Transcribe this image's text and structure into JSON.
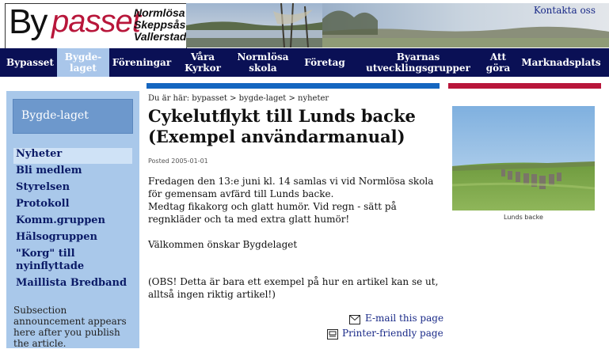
{
  "header": {
    "logo_by": "By",
    "logo_passet": "passet",
    "villages": [
      "Normlösa",
      "Skeppsås",
      "Vallerstad"
    ],
    "contact": "Kontakta oss"
  },
  "nav": {
    "items": [
      {
        "line1": "Bypasset",
        "line2": ""
      },
      {
        "line1": "Bygde-",
        "line2": "laget"
      },
      {
        "line1": "Föreningar",
        "line2": ""
      },
      {
        "line1": "Våra",
        "line2": "Kyrkor"
      },
      {
        "line1": "Normlösa",
        "line2": "skola"
      },
      {
        "line1": "Företag",
        "line2": ""
      },
      {
        "line1": "Byarnas",
        "line2": "utvecklingsgrupper"
      },
      {
        "line1": "Att",
        "line2": "göra"
      },
      {
        "line1": "Marknadsplats",
        "line2": ""
      }
    ]
  },
  "sidebar": {
    "title": "Bygde-laget",
    "links": [
      "Nyheter",
      "Bli medlem",
      "Styrelsen",
      "Protokoll",
      "Komm.gruppen",
      "Hälsogruppen",
      "\"Korg\" till",
      "nyinflyttade",
      "Maillista Bredband"
    ],
    "note": "Subsection announcement appears here after you publish the article."
  },
  "article": {
    "breadcrumb": "Du är här: bypasset > bygde-laget > nyheter",
    "title": "Cykelutflykt till Lunds backe (Exempel användarmanual)",
    "posted": "Posted 2005-01-01",
    "p1": "Fredagen den 13:e juni kl. 14 samlas vi vid Normlösa skola för gemensam avfärd till Lunds backe.",
    "p1b": "Medtag fikakorg och glatt humör. Vid regn - sätt på regnkläder och ta med extra glatt humör!",
    "p2": "Välkommen önskar Bygdelaget",
    "note": "(OBS! Detta är bara ett exempel på hur en artikel kan se ut, alltså ingen riktig artikel!)",
    "email_link": "E-mail this page",
    "print_link": "Printer-friendly page"
  },
  "photo": {
    "caption": "Lunds backe"
  },
  "colors": {
    "nav_bg": "#0a1055",
    "accent_blue": "#1566c0",
    "accent_red": "#b8163a",
    "sidebar_bg": "#a9c8ea"
  }
}
